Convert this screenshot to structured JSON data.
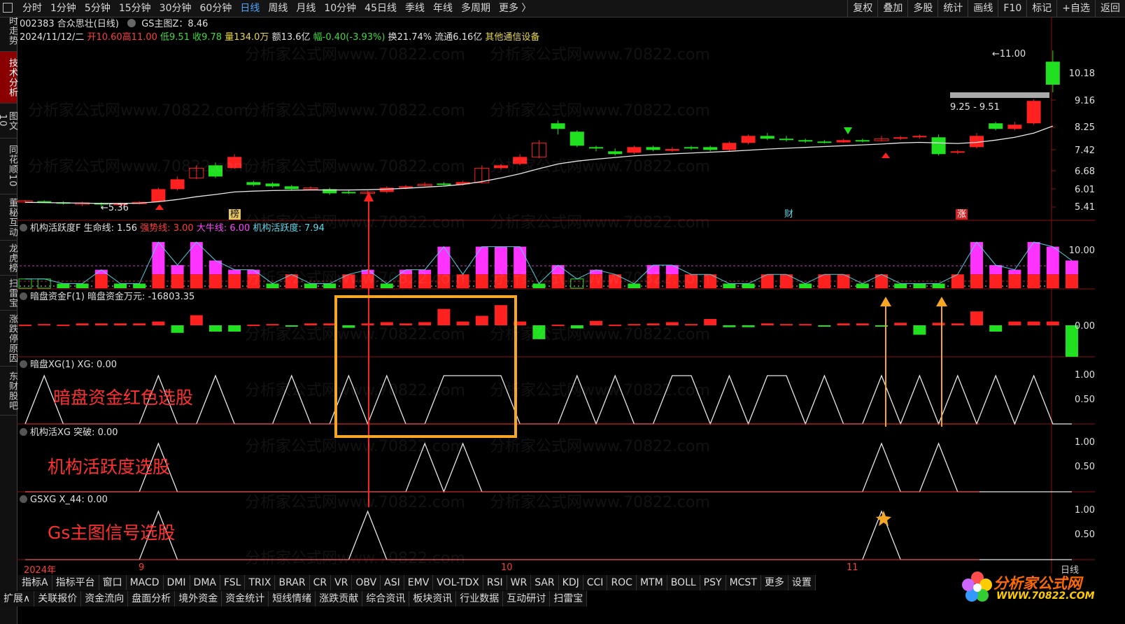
{
  "periods": [
    "分时",
    "1分钟",
    "5分钟",
    "15分钟",
    "30分钟",
    "60分钟",
    "日线",
    "周线",
    "月线",
    "10分钟",
    "45日线",
    "季线",
    "年线",
    "多周期",
    "更多 〉"
  ],
  "active_period": "日线",
  "right_tools": [
    "复权",
    "叠加",
    "多股",
    "统计",
    "画线",
    "F10",
    "标记",
    "+自选",
    "返回"
  ],
  "side_tabs": [
    "分时走势",
    "技术分析",
    "图文10",
    "同花顺10",
    "董秘互动",
    "龙虎榜",
    "扫雷宝",
    "涨跌停原因",
    "东财股吧"
  ],
  "side_active": "技术分析",
  "header": {
    "code_title": "002383 合众思壮(日线)",
    "gs_label": "GS主图Z：8.46",
    "date": "2024/11/12/二",
    "open": "开10.60",
    "high": "高11.00",
    "low": "低9.51",
    "close": "收9.78",
    "volume": "量134.0万",
    "amount": "额13.6亿",
    "change": "幅-0.40(-3.93%)",
    "turnover": "换21.74% 流通6.16亿",
    "sector": "其他通信设备"
  },
  "price_labels": {
    "high_label": "11.00",
    "low_label": "5.36",
    "range_label": "9.25 - 9.51"
  },
  "event_markers": [
    "榜",
    "财",
    "涨"
  ],
  "price_axis": [
    "10.18",
    "9.16",
    "8.25",
    "7.42",
    "6.68",
    "6.01",
    "5.41"
  ],
  "panels": {
    "p1": {
      "name": "机构活跃度F",
      "v1": "生命线: 1.56",
      "v2": "强势线: 3.00",
      "v3": "大牛线: 6.00",
      "v4": "机构活跃度: 7.94",
      "axis": [
        "10.00"
      ]
    },
    "p2": {
      "name": "暗盘资金F(1)",
      "v1": "暗盘资金万元: -16803.35",
      "axis": [
        "0.00"
      ]
    },
    "p3": {
      "name": "暗盘XG(1)",
      "v1": "XG: 0.00",
      "axis": [
        "1.00",
        "0.50"
      ]
    },
    "p4": {
      "name": "机构活XG",
      "v1": "突破: 0.00",
      "axis": [
        "1.00",
        "0.50"
      ]
    },
    "p5": {
      "name": "GSXG",
      "v1": "X_44: 0.00",
      "axis": [
        "1.00",
        "0.50"
      ]
    }
  },
  "annotations": [
    "暗盘资金红色选股",
    "机构活跃度选股",
    "Gs主图信号选股"
  ],
  "time_axis": [
    "2024年",
    "9",
    "10",
    "11",
    "日线"
  ],
  "bottom_row1": [
    "指标A",
    "指标平台",
    "窗口",
    "MACD",
    "DMI",
    "DMA",
    "FSL",
    "TRIX",
    "BRAR",
    "CR",
    "VR",
    "OBV",
    "ASI",
    "EMV",
    "VOL-TDX",
    "RSI",
    "WR",
    "SAR",
    "KDJ",
    "CCI",
    "ROC",
    "MTM",
    "BOLL",
    "PSY",
    "MCST",
    "更多",
    "设置"
  ],
  "bottom_row2": [
    "扩展∧",
    "关联报价",
    "资金流向",
    "盘面分析",
    "境外资金",
    "资金统计",
    "短线情绪",
    "涨跌贡献",
    "综合资讯",
    "板块资讯",
    "行业数据",
    "互动研讨",
    "扫雷宝"
  ],
  "watermark": "分析家公式网www.70822.com",
  "logo": {
    "t1": "分析家公式网",
    "t2": "WWW.70822.COM"
  },
  "colors": {
    "up": "#ff2020",
    "down": "#20e020",
    "accent": "#4aa3ff",
    "highlight_box": "#f5a623",
    "ma_line": "#e8e8e8",
    "activity_bar": "#ff33ff"
  }
}
